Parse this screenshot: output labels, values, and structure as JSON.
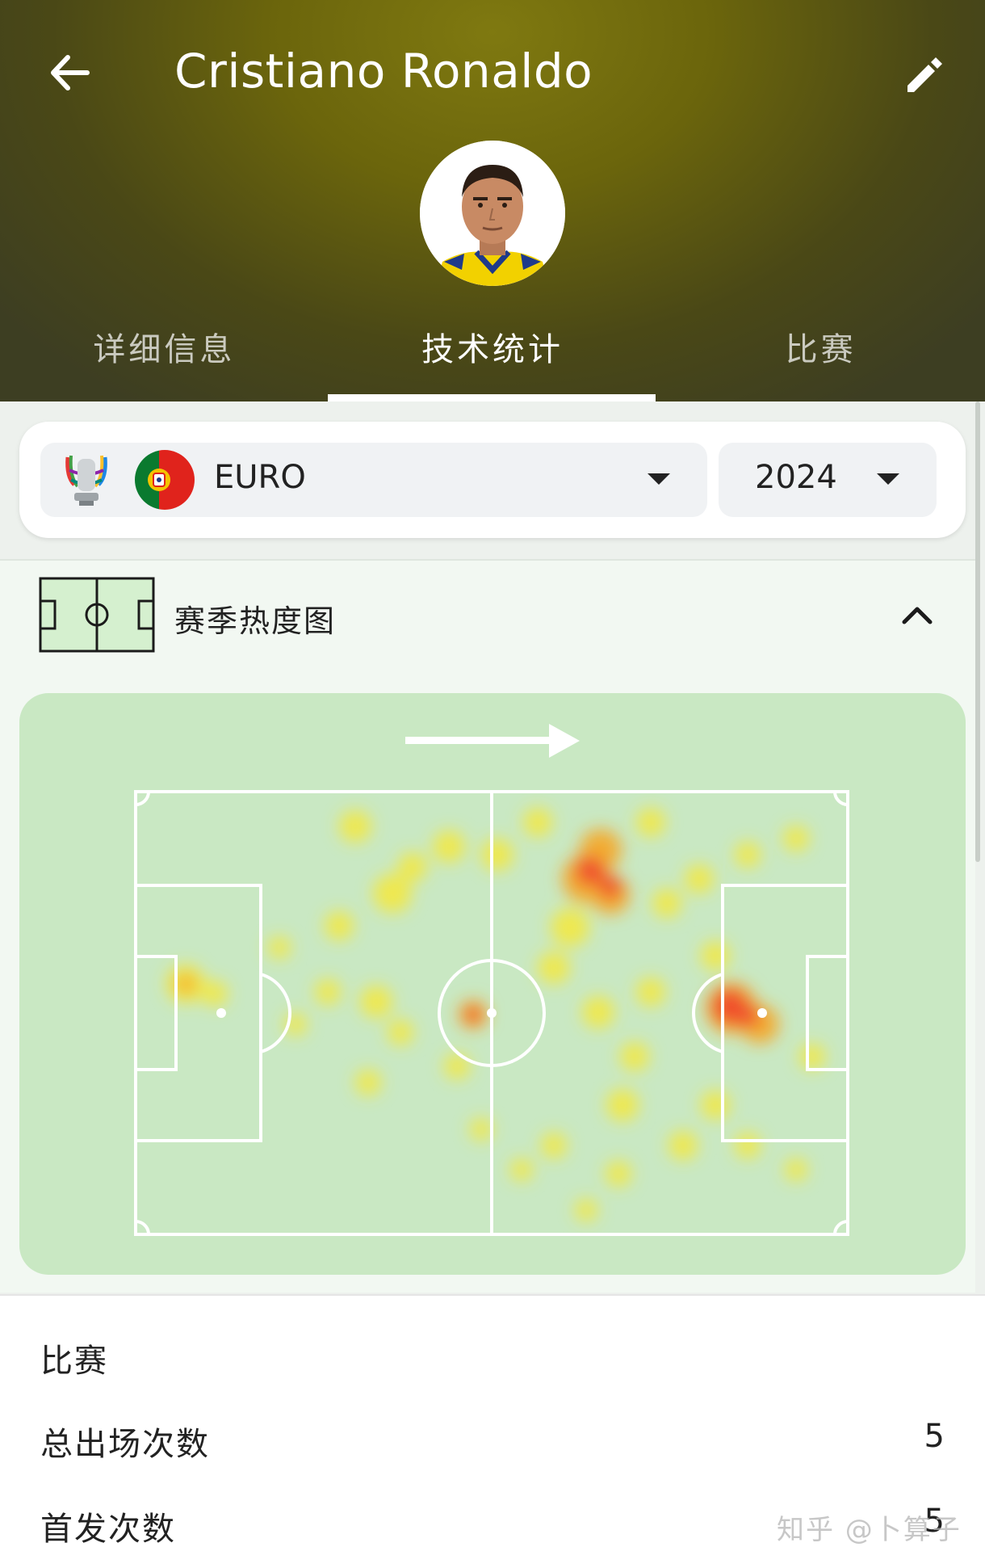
{
  "header": {
    "player_name": "Cristiano Ronaldo",
    "back_icon": "arrow-left-icon",
    "edit_icon": "pencil-icon",
    "tabs": [
      {
        "label": "详细信息",
        "active": false
      },
      {
        "label": "技术统计",
        "active": true
      },
      {
        "label": "比赛",
        "active": false
      }
    ],
    "gradient_color": "#7f7910"
  },
  "filters": {
    "competition": "EURO",
    "competition_logo": "euro-2024-trophy-icon",
    "team_flag": "portugal-flag-icon",
    "season": "2024"
  },
  "heatmap": {
    "title": "赛季热度图",
    "section_icon": "pitch-icon",
    "collapse_icon": "chevron-up-icon",
    "attack_direction": "right",
    "pitch_color": "#c9e8c3"
  },
  "stats": {
    "section_title": "比赛",
    "rows": [
      {
        "label": "总出场次数",
        "value": "5"
      },
      {
        "label": "首发次数",
        "value": "5"
      }
    ]
  },
  "watermark": "知乎 @卜算子"
}
